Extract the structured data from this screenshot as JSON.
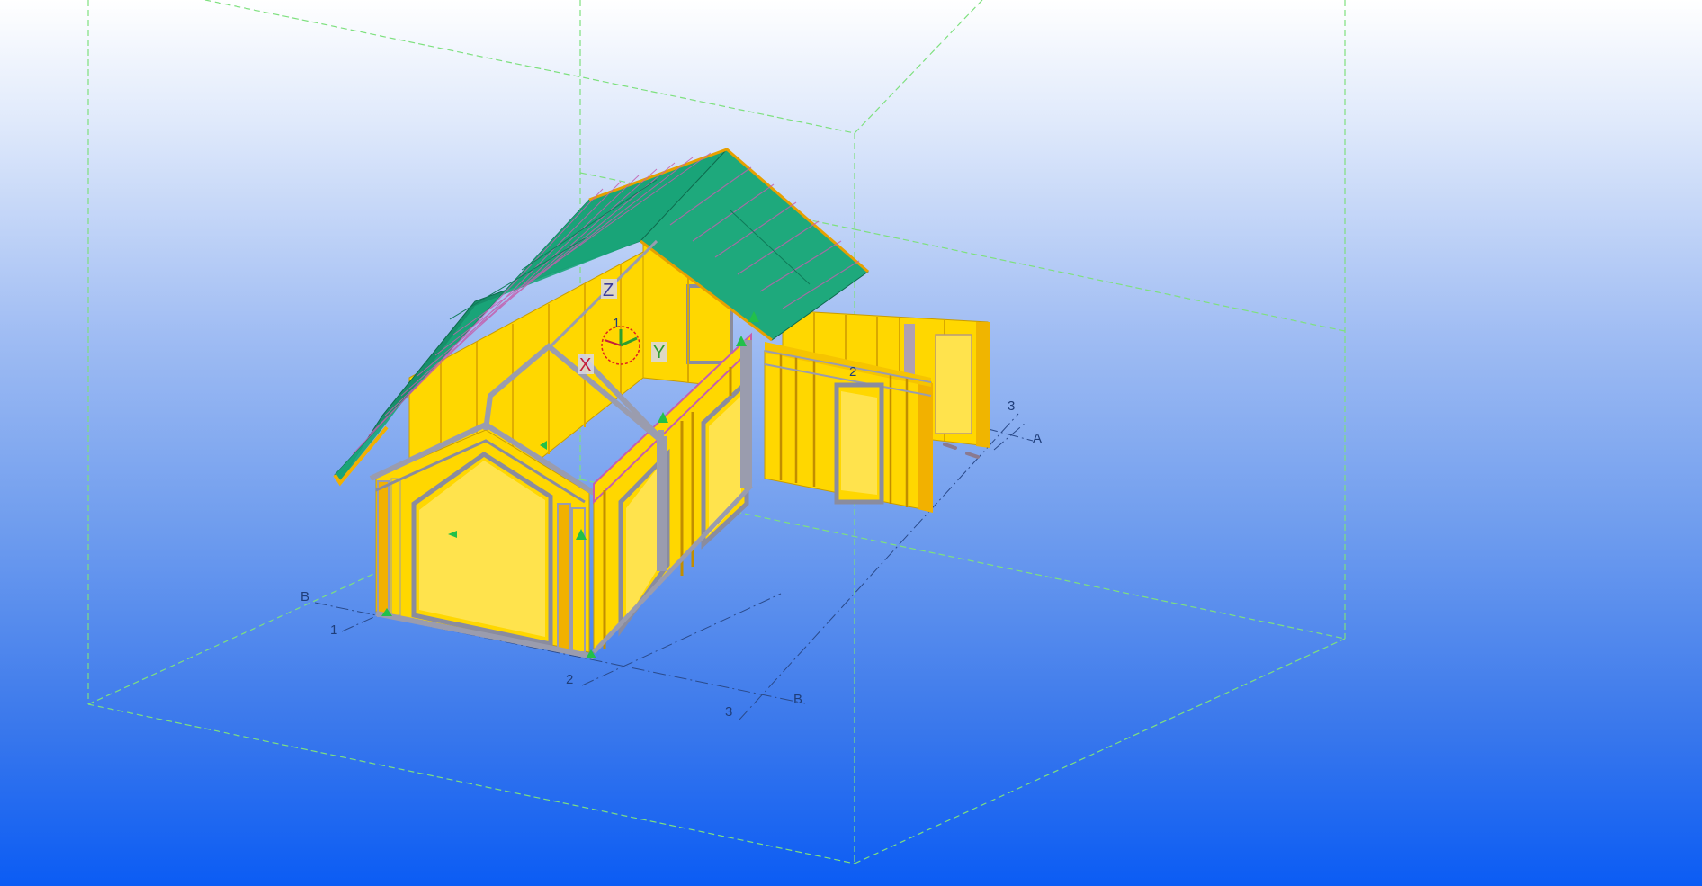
{
  "viewport": {
    "gridlines": {
      "rows": [
        "A",
        "B"
      ],
      "columns": [
        "1",
        "2",
        "3"
      ],
      "labels": {
        "b_left": "B",
        "one_left": "1",
        "two_bottom": "2",
        "three_bottom": "3",
        "b_bottom": "B",
        "three_right": "3",
        "a_right": "A",
        "two_back": "2"
      }
    },
    "coordinate_system": {
      "x": "X",
      "y": "Y",
      "z": "Z",
      "origin_label": "1"
    },
    "colors": {
      "background_top": "#ffffff",
      "background_bottom": "#0b5cf4",
      "wall_panel": "#ffd700",
      "wall_stud": "#f2b100",
      "frame": "#9a9cae",
      "roof_panel": "#1aa67a",
      "bounding_box": "#7ee07e",
      "gridline": "#2a4a8a",
      "axis_x": "#c41e3a",
      "axis_y": "#2e9e2e",
      "axis_z": "#3b3b9a"
    }
  }
}
